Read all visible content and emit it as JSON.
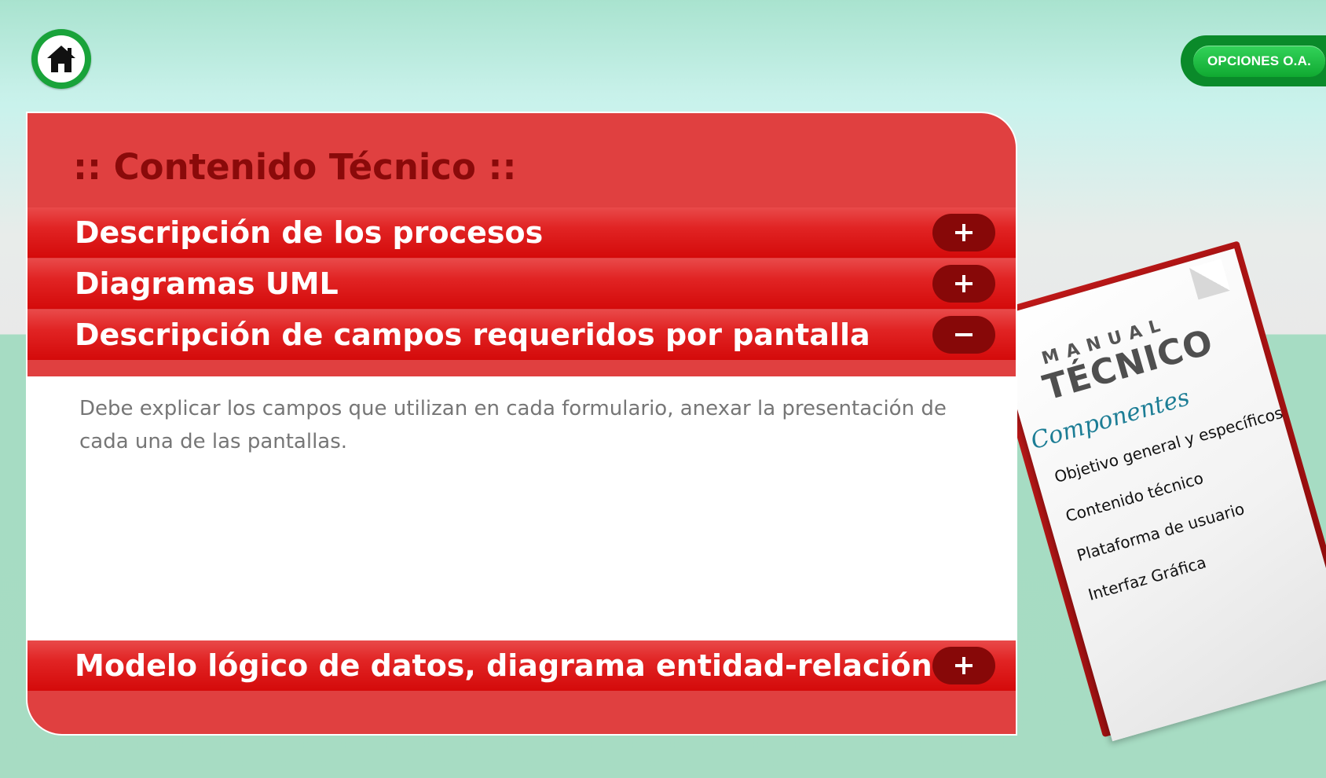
{
  "nav": {
    "home_icon": "home-icon",
    "options_label": "OPCIONES O.A."
  },
  "panel": {
    "title": ":: Contenido Técnico ::",
    "sections": [
      {
        "label": "Descripción de los procesos",
        "expanded": false,
        "toggle_icon": "plus-icon"
      },
      {
        "label": "Diagramas UML",
        "expanded": false,
        "toggle_icon": "plus-icon"
      },
      {
        "label": "Descripción de campos requeridos por pantalla",
        "expanded": true,
        "toggle_icon": "minus-icon",
        "content": "Debe explicar los campos que utilizan en cada formulario, anexar la presentación de cada una de las pantallas."
      },
      {
        "label": "Modelo lógico de datos, diagrama entidad-relación",
        "expanded": false,
        "toggle_icon": "plus-icon"
      }
    ]
  },
  "manual": {
    "kicker": "MANUAL",
    "title": "TÉCNICO",
    "subtitle": "Componentes",
    "items": [
      "Objetivo general y específicos",
      "Contenido técnico",
      "Plataforma de usuario",
      "Interfaz Gráfica"
    ]
  },
  "colors": {
    "panel_red": "#e04040",
    "header_red": "#d40a0a",
    "title_dark_red": "#8a0a0a",
    "toggle_bg": "#870808",
    "green_button": "#10a931",
    "background_mint": "#a9e3cf"
  }
}
